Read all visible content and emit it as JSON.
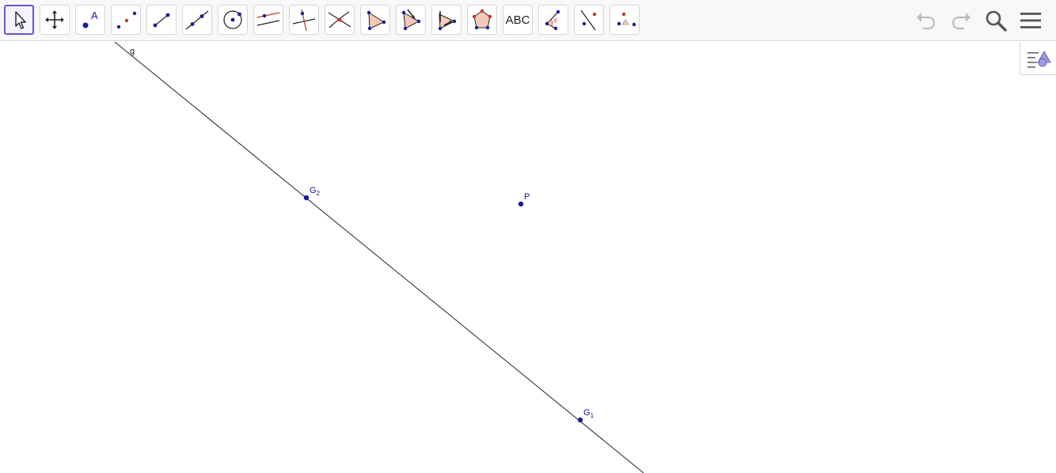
{
  "toolbar": {
    "tools": [
      {
        "name": "move-tool",
        "icon": "arrow-cursor-icon",
        "selected": true
      },
      {
        "name": "move-graphics-view-tool",
        "icon": "move-cross-icon"
      },
      {
        "name": "point-tool",
        "icon": "point-icon",
        "label": "A"
      },
      {
        "name": "point-pair-tool",
        "icon": "two-points-icon"
      },
      {
        "name": "segment-tool",
        "icon": "segment-icon"
      },
      {
        "name": "line-tool",
        "icon": "line-icon"
      },
      {
        "name": "circle-tool",
        "icon": "circle-icon"
      },
      {
        "name": "parallel-line-tool",
        "icon": "parallel-line-icon"
      },
      {
        "name": "perpendicular-line-tool",
        "icon": "perpendicular-line-icon"
      },
      {
        "name": "intersect-tool",
        "icon": "intersect-icon"
      },
      {
        "name": "polygon-tool",
        "icon": "polygon-icon"
      },
      {
        "name": "reflect-tool",
        "icon": "reflect-icon"
      },
      {
        "name": "translate-tool",
        "icon": "translate-icon"
      },
      {
        "name": "regular-polygon-tool",
        "icon": "pentagon-icon"
      },
      {
        "name": "text-tool",
        "icon": "text-icon",
        "label": "ABC"
      },
      {
        "name": "angle-tool",
        "icon": "angle-icon",
        "label": "α"
      },
      {
        "name": "line-point-tool",
        "icon": "line-point-icon"
      },
      {
        "name": "distance-tool",
        "icon": "distance-icon"
      }
    ],
    "undo_icon": "undo-icon",
    "redo_icon": "redo-icon",
    "search_icon": "search-icon",
    "menu_icon": "menu-icon"
  },
  "algebra_toggle_icon": "algebra-view-icon",
  "canvas": {
    "line_label": "g",
    "points": [
      {
        "name": "G",
        "sub": "2"
      },
      {
        "name": "P",
        "sub": ""
      },
      {
        "name": "G",
        "sub": "1"
      }
    ]
  },
  "colors": {
    "point": "#1a1a9c",
    "red_point": "#c0392b",
    "selected_border": "#6557d2",
    "polygon_fill": "#f4c9b8"
  }
}
